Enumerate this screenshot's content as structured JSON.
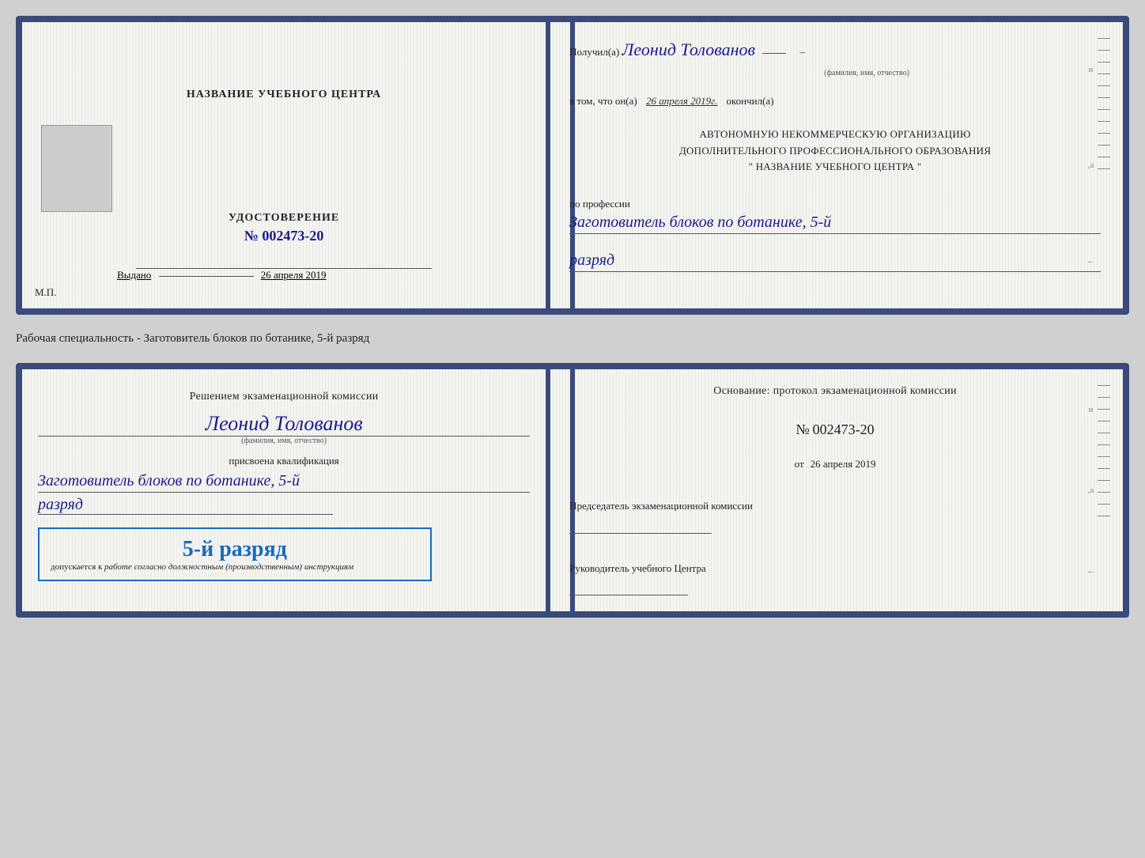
{
  "doc1": {
    "left": {
      "cert_title": "УДОСТОВЕРЕНИЕ",
      "cert_number_label": "№",
      "cert_number": "002473-20",
      "issued_label": "Выдано",
      "issued_date": "26 апреля 2019",
      "mp_label": "М.П.",
      "training_center": "НАЗВАНИЕ УЧЕБНОГО ЦЕНТРА"
    },
    "right": {
      "recipient_prefix": "Получил(а)",
      "recipient_name": "Леонид Толованов",
      "fio_label": "(фамилия, имя, отчество)",
      "date_prefix": "в том, что он(а)",
      "date_value": "26 апреля 2019г.",
      "date_suffix": "окончил(а)",
      "org_line1": "АВТОНОМНУЮ НЕКОММЕРЧЕСКУЮ ОРГАНИЗАЦИЮ",
      "org_line2": "ДОПОЛНИТЕЛЬНОГО ПРОФЕССИОНАЛЬНОГО ОБРАЗОВАНИЯ",
      "org_line3": "\"  НАЗВАНИЕ УЧЕБНОГО ЦЕНТРА  \"",
      "profession_label": "по профессии",
      "profession_value": "Заготовитель блоков по ботанике, 5-й",
      "rank_value": "разряд"
    }
  },
  "specialty_label": "Рабочая специальность - Заготовитель блоков по ботанике, 5-й разряд",
  "doc2": {
    "left": {
      "commission_text": "Решением экзаменационной комиссии",
      "person_name": "Леонид Толованов",
      "fio_label": "(фамилия, имя, отчество)",
      "assigned_label": "присвоена квалификация",
      "qual_value": "Заготовитель блоков по ботанике, 5-й",
      "rank_value": "разряд",
      "stamp_rank": "5-й разряд",
      "stamp_prefix": "допускается к",
      "stamp_italic": "работе согласно должностным (производственным) инструкциям"
    },
    "right": {
      "basis_label": "Основание: протокол экзаменационной комиссии",
      "number_prefix": "№",
      "number_value": "002473-20",
      "date_prefix": "от",
      "date_value": "26 апреля 2019",
      "chairman_label": "Председатель экзаменационной комиссии",
      "director_label": "Руководитель учебного Центра"
    }
  }
}
